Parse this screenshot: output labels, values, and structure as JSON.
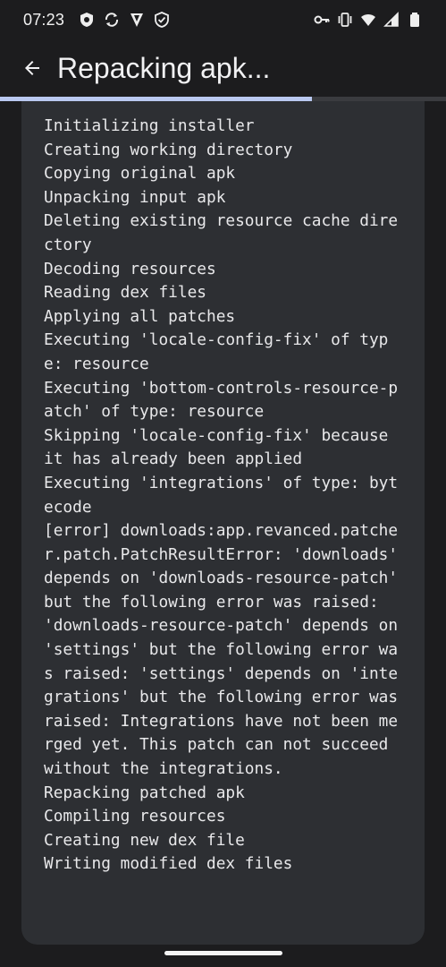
{
  "status_bar": {
    "time": "07:23",
    "left_icons": [
      "shield-app-icon",
      "sync-icon",
      "vpn-v-icon",
      "shield-check-icon"
    ],
    "right_icons": [
      "key-icon",
      "vibrate-icon",
      "wifi-icon",
      "cell-signal-icon",
      "battery-icon"
    ]
  },
  "app_bar": {
    "title": "Repacking apk..."
  },
  "progress": {
    "fraction": 0.7
  },
  "log": {
    "lines": [
      "Initializing installer",
      "Creating working directory",
      "Copying original apk",
      "Unpacking input apk",
      "Deleting existing resource cache directory",
      "Decoding resources",
      "Reading dex files",
      "Applying all patches",
      "Executing 'locale-config-fix' of type: resource",
      "Executing 'bottom-controls-resource-patch' of type: resource",
      "Skipping 'locale-config-fix' because it has already been applied",
      "Executing 'integrations' of type: bytecode",
      "[error] downloads:app.revanced.patcher.patch.PatchResultError: 'downloads' depends on 'downloads-resource-patch' but the following error was raised: 'downloads-resource-patch' depends on 'settings' but the following error was raised: 'settings' depends on 'integrations' but the following error was raised: Integrations have not been merged yet. This patch can not succeed without the integrations.",
      "Repacking patched apk",
      "Compiling resources",
      "Creating new dex file",
      "Writing modified dex files"
    ]
  },
  "colors": {
    "background": "#1c1c1e",
    "card": "#2d2f33",
    "progress_fill": "#b9c8f0",
    "progress_track": "#3a3b3f",
    "text": "#e8e8ea"
  }
}
